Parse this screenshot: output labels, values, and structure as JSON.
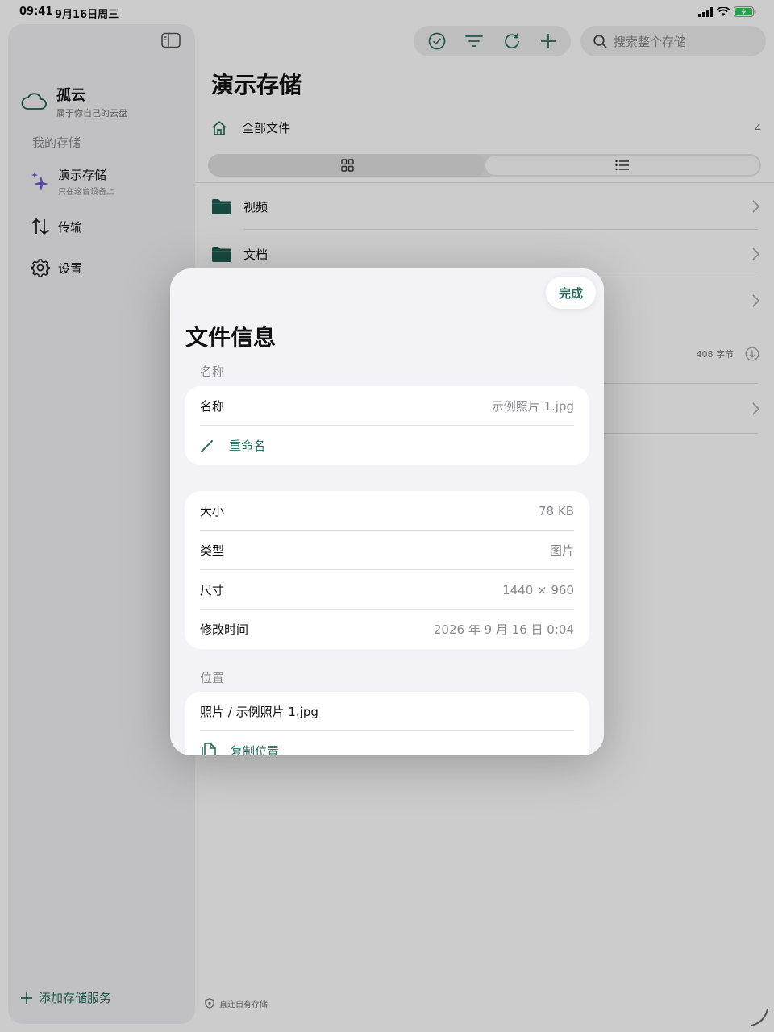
{
  "status_bar": {
    "time": "09:41",
    "date": "9月16日周三"
  },
  "sidebar": {
    "app_name": "孤云",
    "app_tagline": "属于你自己的云盘",
    "section_label": "我的存储",
    "storage": {
      "title": "演示存储",
      "subtitle": "只在这台设备上"
    },
    "nav": [
      {
        "label": "传输"
      },
      {
        "label": "设置"
      }
    ],
    "add_service": "添加存储服务"
  },
  "toolbar": {
    "search_placeholder": "搜索整个存储"
  },
  "main": {
    "title": "演示存储",
    "breadcrumb": "全部文件",
    "count": "4",
    "rows": [
      {
        "label": "视频"
      },
      {
        "label": "文档"
      }
    ],
    "row_size": "408 字节",
    "footer": "直连自有存储"
  },
  "modal": {
    "done_label": "完成",
    "title": "文件信息",
    "name_section": "名称",
    "name_label": "名称",
    "name_value": "示例照片 1.jpg",
    "rename_label": "重命名",
    "details": [
      {
        "label": "大小",
        "value": "78 KB"
      },
      {
        "label": "类型",
        "value": "图片"
      },
      {
        "label": "尺寸",
        "value": "1440 × 960"
      },
      {
        "label": "修改时间",
        "value": "2026 年 9 月 16 日 0:04"
      }
    ],
    "location_section": "位置",
    "location_path": "照片 / 示例照片 1.jpg",
    "copy_location_label": "复制位置"
  },
  "colors": {
    "accent": "#2a6b60",
    "folder": "#1f5a4f",
    "sparkle": "#6b5bd6",
    "battery": "#35c759"
  }
}
